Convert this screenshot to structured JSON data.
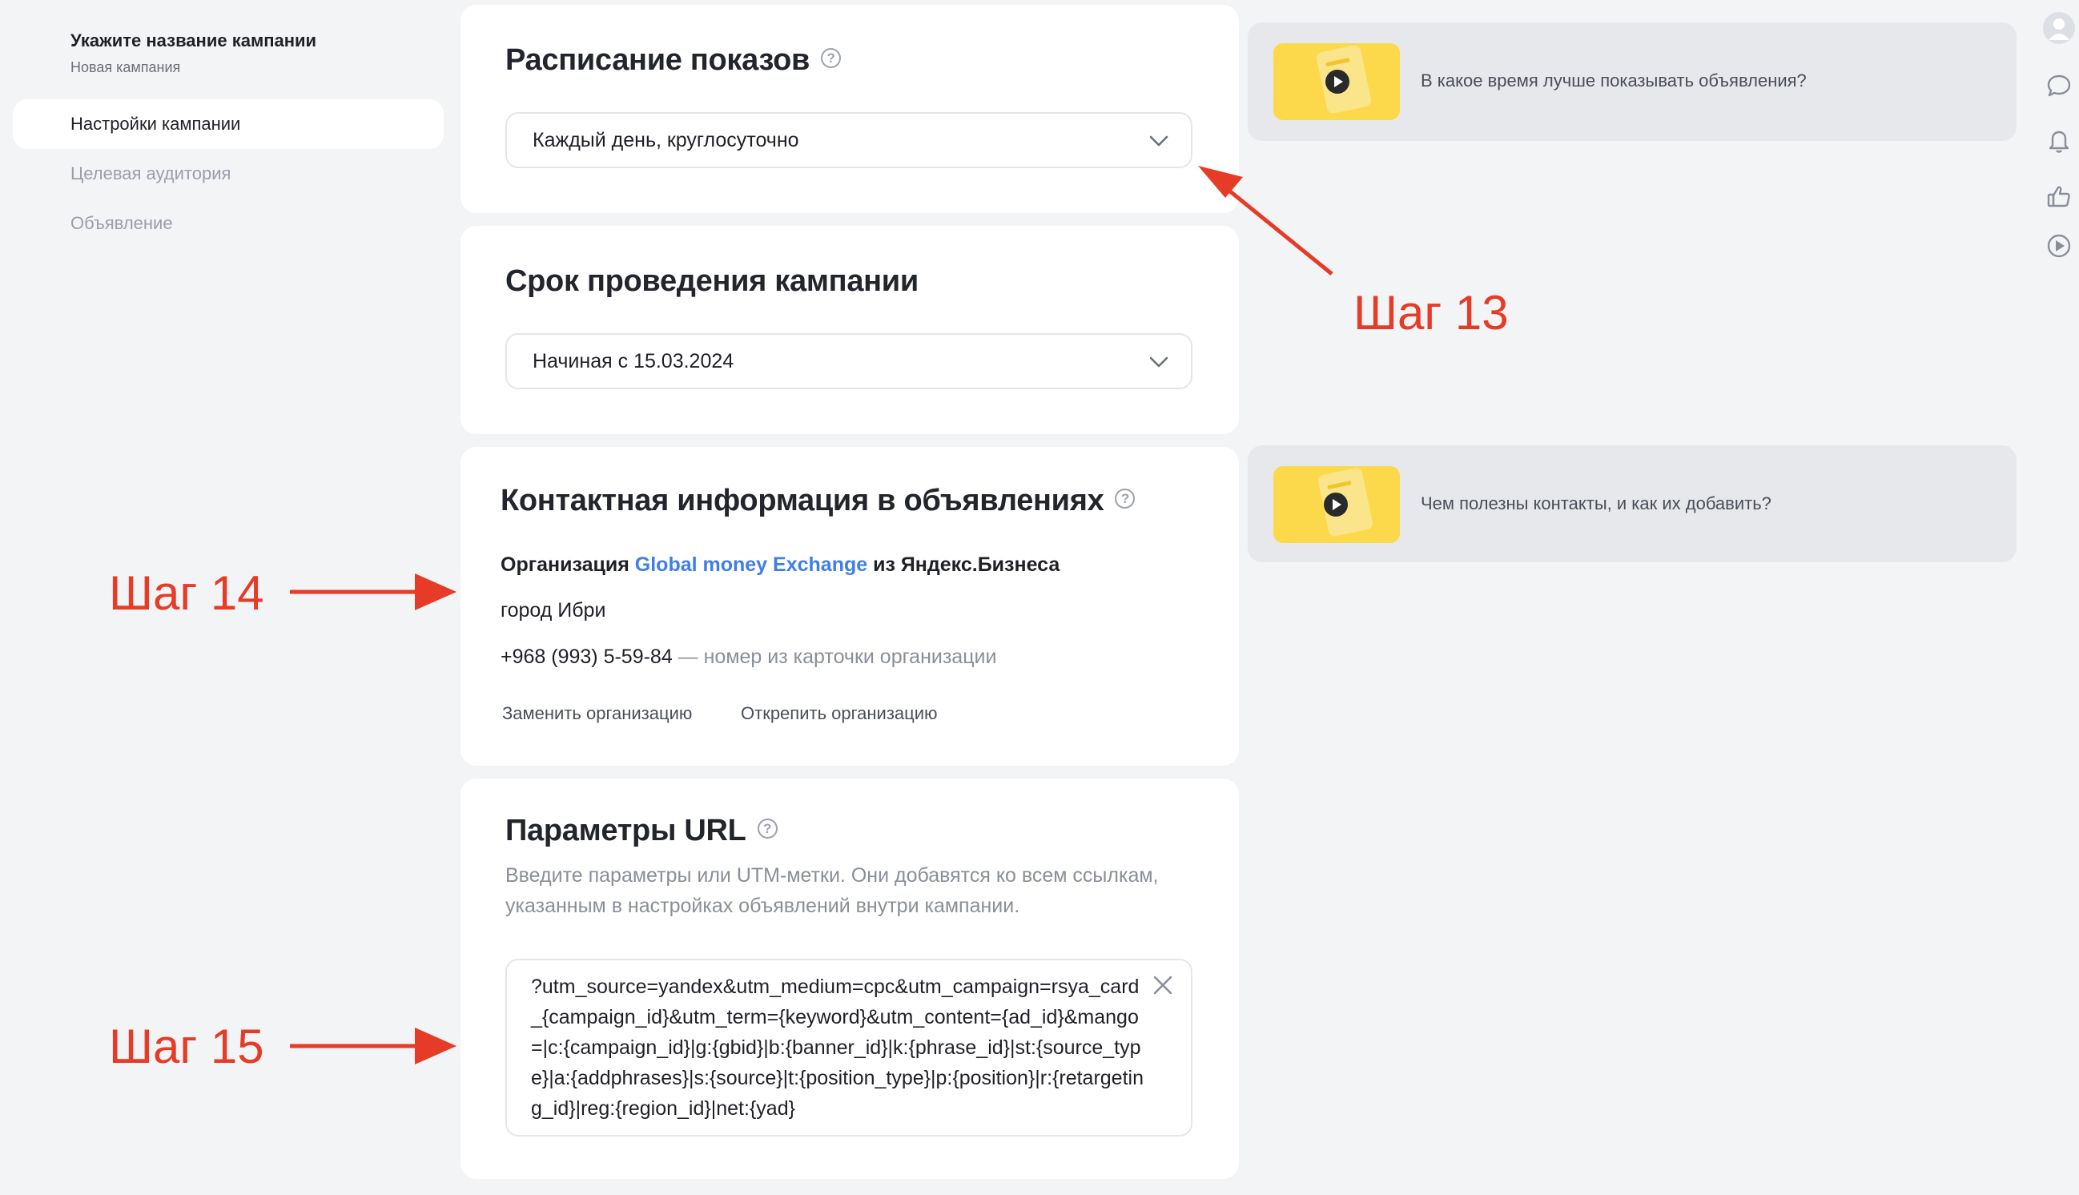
{
  "sidebar": {
    "campaign_title": "Укажите название кампании",
    "campaign_subtitle": "Новая кампания",
    "items": [
      {
        "label": "Настройки кампании",
        "active": true
      },
      {
        "label": "Целевая аудитория",
        "active": false
      },
      {
        "label": "Объявление",
        "active": false
      }
    ]
  },
  "schedule": {
    "title": "Расписание показов",
    "help": "?",
    "value": "Каждый день, круглосуточно"
  },
  "duration": {
    "title": "Срок проведения кампании",
    "value": "Начиная с 15.03.2024"
  },
  "contacts": {
    "title": "Контактная информация в объявлениях",
    "help": "?",
    "org_prefix": "Организация ",
    "org_name": "Global money Exchange",
    "org_suffix": " из Яндекс.Бизнеса",
    "city": "город Ибри",
    "phone": "+968 (993) 5-59-84",
    "phone_note": " — номер из карточки организации",
    "replace_label": "Заменить организацию",
    "detach_label": "Открепить организацию"
  },
  "url_params": {
    "title": "Параметры URL",
    "help": "?",
    "description_line1": "Введите параметры или UTM-метки. Они добавятся ко всем ссылкам,",
    "description_line2": "указанным в настройках объявлений внутри кампании.",
    "value": "?utm_source=yandex&utm_medium=cpc&utm_campaign=rsya_card_{campaign_id}&utm_term={keyword}&utm_content={ad_id}&mango=|c:{campaign_id}|g:{gbid}|b:{banner_id}|k:{phrase_id}|st:{source_type}|a:{addphrases}|s:{source}|t:{position_type}|p:{position}|r:{retargeting_id}|reg:{region_id}|net:{yad}"
  },
  "tips": [
    {
      "text": "В какое время лучше показывать объявления?"
    },
    {
      "text": "Чем полезны контакты, и как их добавить?"
    }
  ],
  "rail_icons": [
    "avatar",
    "chat-icon",
    "bell-icon",
    "thumbs-up-icon",
    "play-circle-icon"
  ],
  "annotations": {
    "step13": "Шаг 13",
    "step14": "Шаг 14",
    "step15": "Шаг 15",
    "color": "#e63b27"
  },
  "colors": {
    "background": "#f3f4f6",
    "card": "#ffffff",
    "link": "#3f7ee8",
    "thumb": "#fcd94b"
  }
}
